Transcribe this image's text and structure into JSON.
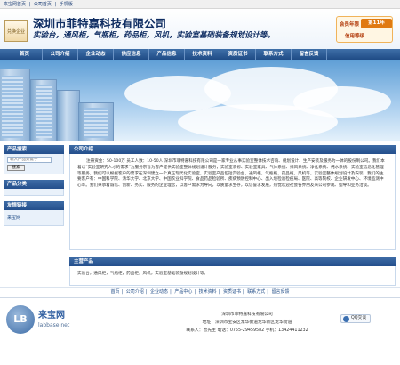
{
  "topbar": {
    "links": [
      "来宝网首页",
      "公司首页",
      "手机版"
    ],
    "sep": "|"
  },
  "header": {
    "logo_text": "兑换企业",
    "company_name": "深圳市菲特嘉科技有限公司",
    "slogan": "实验台，通风柜，气瓶柜，药品柜，风机，实验室基础装备规划设计等。",
    "badge": {
      "member_label": "会员年限",
      "years": "第11年",
      "bottom_text": "信用等级"
    }
  },
  "nav": {
    "items": [
      "首页",
      "公司介绍",
      "企业动态",
      "供应信息",
      "产品信息",
      "技术资料",
      "资质证书",
      "联系方式",
      "留言反馈"
    ]
  },
  "sidebar": {
    "search_title": "产品搜索",
    "search_placeholder": "输入产品关键字",
    "search_button": "搜索",
    "category_title": "产品分类",
    "friend_title": "友情链接",
    "friend_links": [
      "来宝网"
    ]
  },
  "main": {
    "intro_title": "公司介绍",
    "intro_text": "注册资金：50-100万 员工人数：10-50人 深圳市菲特嘉科技有限公司是一家专业从事实验室整体技术咨询、规划设计、生产安装及服务为一体的股份制公司。我们本着以“实验室研究人才的需求”为服务宗旨为客户提供实验室整体规划设计服务，实验室装修、实验室家具、气体系统、排风系统、净化系统、纯水系统、实验室信息化管理等服务，我们可以根据客户的需求在深圳建立一个真正现代化实验室，实验室产品包括实验台，通风柜，气瓶柜，药品柜，风机等。实验室整体规划设计及安装，我们的主要客户有：中国科学院、清华大学、北京大学、中国农业科学院、食品药品检验所、疾病预防控制中心、出入境检验检疫局、医院、高等院校、企业研发中心、环境监测中心等。我们秉承着诚信、创新、务实、服务的企业理念，以客户需求为导向，以质量求生存，以信誉求发展，热忱欢迎社会各界朋友来公司参观、指导和业务洽谈。",
    "product_title": "主营产品",
    "product_text": "实验台，通风柜，气瓶柜，药品柜，风机，实验室基础装备规划设计等。"
  },
  "footer_links": [
    "首页",
    "公司介绍",
    "企业动态",
    "产品中心",
    "技术资料",
    "资质证书",
    "联系方式",
    "留言反馈"
  ],
  "footer": {
    "logo_cn": "来宝网",
    "logo_url": "labbase.net",
    "copyright": "深圳市菲特嘉科技有限公司",
    "address": "地址：深圳市宝安区龙华街道龙华新区龙华街道",
    "contact": "联系人：曾先生 电话：0755-29459582 手机：13424411232",
    "qq_label": "QQ交谈"
  }
}
